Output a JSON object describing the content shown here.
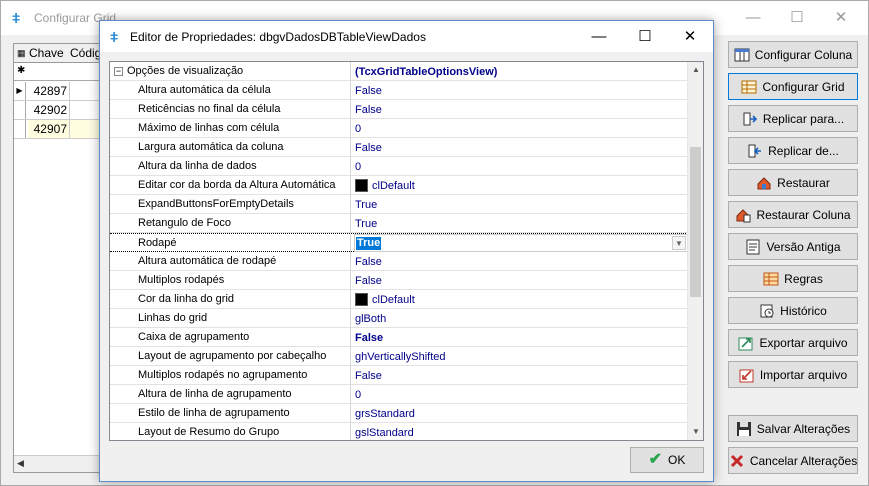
{
  "main_window": {
    "title": "Configurar Grid",
    "grid": {
      "columns": [
        "Chave",
        "Códig"
      ],
      "rows": [
        "42897",
        "42902",
        "42907"
      ]
    }
  },
  "side_buttons": [
    {
      "label": "Configurar Coluna",
      "icon": "columns-icon"
    },
    {
      "label": "Configurar Grid",
      "icon": "grid-config-icon"
    },
    {
      "label": "Replicar para...",
      "icon": "replicate-to-icon"
    },
    {
      "label": "Replicar de...",
      "icon": "replicate-from-icon"
    },
    {
      "label": "Restaurar",
      "icon": "restore-icon"
    },
    {
      "label": "Restaurar Coluna",
      "icon": "restore-column-icon"
    },
    {
      "label": "Versão Antiga",
      "icon": "old-version-icon"
    },
    {
      "label": "Regras",
      "icon": "rules-icon"
    },
    {
      "label": "Histórico",
      "icon": "history-icon"
    },
    {
      "label": "Exportar arquivo",
      "icon": "export-icon"
    },
    {
      "label": "Importar arquivo",
      "icon": "import-icon"
    },
    {
      "label": "Salvar Alterações",
      "icon": "save-icon"
    },
    {
      "label": "Cancelar Alterações",
      "icon": "cancel-icon"
    }
  ],
  "dialog": {
    "title": "Editor de Propriedades: dbgvDadosDBTableViewDados",
    "ok_label": "OK",
    "group": {
      "name": "Opções de visualização",
      "value": "(TcxGridTableOptionsView)",
      "expander": "−"
    },
    "properties": [
      {
        "name": "Altura automática da célula",
        "value": "False"
      },
      {
        "name": "Reticências no final da célula",
        "value": "False"
      },
      {
        "name": "Máximo de linhas com célula",
        "value": "0"
      },
      {
        "name": "Largura automática da coluna",
        "value": "False"
      },
      {
        "name": "Altura da linha de dados",
        "value": "0"
      },
      {
        "name": "Editar cor da borda da Altura Automática",
        "value": "clDefault",
        "swatch": "#000000"
      },
      {
        "name": "ExpandButtonsForEmptyDetails",
        "value": "True"
      },
      {
        "name": "Retangulo de Foco",
        "value": "True"
      },
      {
        "name": "Rodapé",
        "value": "True",
        "selected": true
      },
      {
        "name": "Altura automática de rodapé",
        "value": "False"
      },
      {
        "name": "Multiplos rodapés",
        "value": "False"
      },
      {
        "name": "Cor da linha do grid",
        "value": "clDefault",
        "swatch": "#000000"
      },
      {
        "name": "Linhas do grid",
        "value": "glBoth"
      },
      {
        "name": "Caixa de agrupamento",
        "value": "False",
        "bold": true
      },
      {
        "name": "Layout de agrupamento por cabeçalho",
        "value": "ghVerticallyShifted"
      },
      {
        "name": "Multiplos rodapés no agrupamento",
        "value": "False"
      },
      {
        "name": "Altura de linha de agrupamento",
        "value": "0"
      },
      {
        "name": "Estilo de linha de agrupamento",
        "value": "grsStandard"
      },
      {
        "name": "Layout de Resumo do Grupo",
        "value": "gslStandard"
      }
    ]
  },
  "colors": {
    "value_text": "#00008b",
    "selection": "#0078d7",
    "dialog_border": "#5c8ac9",
    "ok_check": "#2aa44f"
  }
}
